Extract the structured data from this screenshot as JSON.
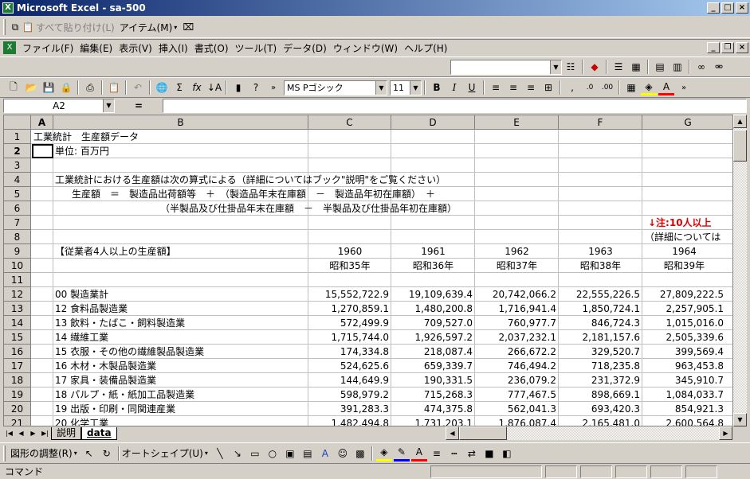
{
  "window": {
    "title": "Microsoft Excel - sa-500"
  },
  "clipboard_bar": {
    "copy_label": "",
    "paste_all_label": "すべて貼り付け(L)",
    "items_label": "アイテム(M)"
  },
  "menus": [
    "ファイル(F)",
    "編集(E)",
    "表示(V)",
    "挿入(I)",
    "書式(O)",
    "ツール(T)",
    "データ(D)",
    "ウィンドウ(W)",
    "ヘルプ(H)"
  ],
  "format": {
    "font": "MS Pゴシック",
    "size": "11"
  },
  "formula": {
    "namebox": "A2",
    "eq": "=",
    "value": ""
  },
  "columns": [
    "A",
    "B",
    "C",
    "D",
    "E",
    "F",
    "G"
  ],
  "rows": [
    "1",
    "2",
    "3",
    "4",
    "5",
    "6",
    "7",
    "8",
    "9",
    "10",
    "11",
    "12",
    "13",
    "14",
    "15",
    "16",
    "17",
    "18",
    "19",
    "20",
    "21"
  ],
  "sheet": {
    "a1": "工業統計　生産額データ",
    "b2": "単位: 百万円",
    "b4": "工業統計における生産額は次の算式による（詳細についてはブック\"説明\"をご覧ください）",
    "b5": "生産額　＝　製造品出荷額等　＋　（製造品年末在庫額　－　製造品年初在庫額）　＋",
    "b6": "（半製品及び仕掛品年末在庫額　－　半製品及び仕掛品年初在庫額）",
    "g7": "↓注:10人以上",
    "g8": "（詳細については",
    "b9": "【従業者4人以上の生産額】",
    "years": [
      "1960",
      "1961",
      "1962",
      "1963",
      "1964"
    ],
    "eras": [
      "昭和35年",
      "昭和36年",
      "昭和37年",
      "昭和38年",
      "昭和39年"
    ],
    "data": [
      {
        "label": "00 製造業計",
        "values": [
          "15,552,722.9",
          "19,109,639.4",
          "20,742,066.2",
          "22,555,226.5",
          "27,809,222.5"
        ]
      },
      {
        "label": "12 食料品製造業",
        "values": [
          "1,270,859.1",
          "1,480,200.8",
          "1,716,941.4",
          "1,850,724.1",
          "2,257,905.1"
        ]
      },
      {
        "label": "13 飲料・たばこ・飼料製造業",
        "values": [
          "572,499.9",
          "709,527.0",
          "760,977.7",
          "846,724.3",
          "1,015,016.0"
        ]
      },
      {
        "label": "14 繊維工業",
        "values": [
          "1,715,744.0",
          "1,926,597.2",
          "2,037,232.1",
          "2,181,157.6",
          "2,505,339.6"
        ]
      },
      {
        "label": "15 衣服・その他の繊維製品製造業",
        "values": [
          "174,334.8",
          "218,087.4",
          "266,672.2",
          "329,520.7",
          "399,569.4"
        ]
      },
      {
        "label": "16 木材・木製品製造業",
        "values": [
          "524,625.6",
          "659,339.7",
          "746,494.2",
          "718,235.8",
          "963,453.8"
        ]
      },
      {
        "label": "17 家具・装備品製造業",
        "values": [
          "144,649.9",
          "190,331.5",
          "236,079.2",
          "231,372.9",
          "345,910.7"
        ]
      },
      {
        "label": "18 パルプ・紙・紙加工品製造業",
        "values": [
          "598,979.2",
          "715,268.3",
          "777,467.5",
          "898,669.1",
          "1,084,033.7"
        ]
      },
      {
        "label": "19 出版・印刷・同関連産業",
        "values": [
          "391,283.3",
          "474,375.8",
          "562,041.3",
          "693,420.3",
          "854,921.3"
        ]
      },
      {
        "label": "20 化学工業",
        "values": [
          "1,482,494.8",
          "1,731,203.1",
          "1,876,087.4",
          "2,165,481.0",
          "2,600,564.8"
        ]
      }
    ]
  },
  "tabs": [
    "説明",
    "data"
  ],
  "drawing": {
    "adjust_label": "図形の調整(R)",
    "autoshape_label": "オートシェイプ(U)"
  },
  "status": {
    "text": "コマンド"
  }
}
